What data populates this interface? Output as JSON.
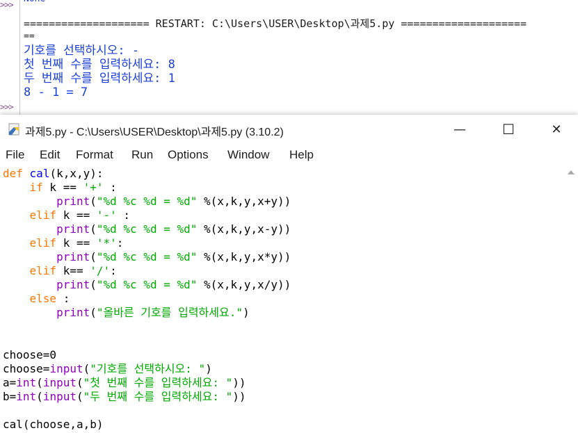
{
  "shell": {
    "prompt": ">>>",
    "top_text": "None",
    "restart_line": "==================== RESTART: C:\\Users\\USER\\Desktop\\과제5.py ====================",
    "restart_wrap": "==",
    "outputs": [
      "기호를 선택하시오: -",
      "첫 번째 수를 입력하세요: 8",
      "두 번째 수를 입력하세요: 1",
      "8 - 1 = 7"
    ]
  },
  "editor": {
    "title": "과제5.py - C:\\Users\\USER\\Desktop\\과제5.py (3.10.2)",
    "window_buttons": {
      "minimize": "—",
      "maximize": "☐",
      "close": "✕"
    },
    "menu": [
      "File",
      "Edit",
      "Format",
      "Run",
      "Options",
      "Window",
      "Help"
    ],
    "code": {
      "l1_def": "def",
      "l1_name": "cal",
      "l1_rest": "(k,x,y):",
      "l2_kw": "if",
      "l2_rest1": " k == ",
      "l2_str": "'+'",
      "l2_rest2": " :",
      "print": "print",
      "fmt": "\"%d %c %d = %d\"",
      "args_add": " %(x,k,y,x+y))",
      "l4_kw": "elif",
      "l4_rest1": " k == ",
      "l4_str": "'-'",
      "l4_rest2": " :",
      "args_sub": " %(x,k,y,x-y))",
      "l6_kw": "elif",
      "l6_rest1": " k == ",
      "l6_str": "'*'",
      "l6_rest2": ":",
      "args_mul": " %(x,k,y,x*y))",
      "l8_kw": "elif",
      "l8_rest1": " k== ",
      "l8_str": "'/'",
      "l8_rest2": ":",
      "args_div": " %(x,k,y,x/y))",
      "l10_kw": "else",
      "l10_rest": " :",
      "l11_str": "\"올바른 기호를 입력하세요.\"",
      "l11_rest": ")",
      "l14": "choose=0",
      "l15_a": "choose=",
      "l15_fn": "input",
      "l15_str": "\"기호를 선택하시오: \"",
      "l15_close": ")",
      "l16_a": "a=",
      "l16_int": "int",
      "l16_fn": "input",
      "l16_str": "\"첫 번째 수를 입력하세요: \"",
      "l17_a": "b=",
      "l17_int": "int",
      "l17_fn": "input",
      "l17_str": "\"두 번째 수를 입력하세요: \"",
      "close2": "))",
      "open": "(",
      "l19": "cal(choose,a,b)"
    }
  }
}
